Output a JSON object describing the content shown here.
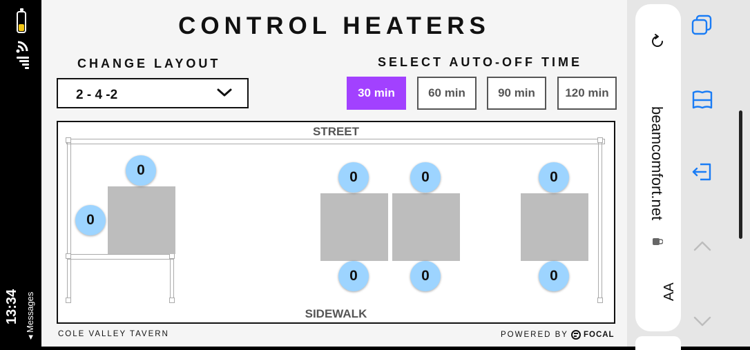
{
  "status_bar": {
    "time": "13:34",
    "back_label": "◂ Messages",
    "battery_color": "#f3c614"
  },
  "app": {
    "title": "CONTROL HEATERS",
    "change_layout_label": "CHANGE LAYOUT",
    "layout_value": "2 - 4 -2",
    "auto_off_label": "SELECT AUTO-OFF TIME",
    "time_options": [
      "30 min",
      "60 min",
      "90 min",
      "120 min"
    ],
    "selected_time": "30 min",
    "accent_color": "#a241ff",
    "heater_color": "#9dd4ff",
    "map": {
      "street_label": "STREET",
      "sidewalk_label": "SIDEWALK",
      "heaters": [
        "0",
        "0",
        "0",
        "0",
        "0",
        "0",
        "0",
        "0"
      ]
    },
    "footer": {
      "venue": "COLE VALLEY TAVERN",
      "powered_by": "POWERED BY",
      "brand": "FOCAL"
    }
  },
  "browser": {
    "url": "beamcomfort.net",
    "text_size_label": "AA"
  }
}
